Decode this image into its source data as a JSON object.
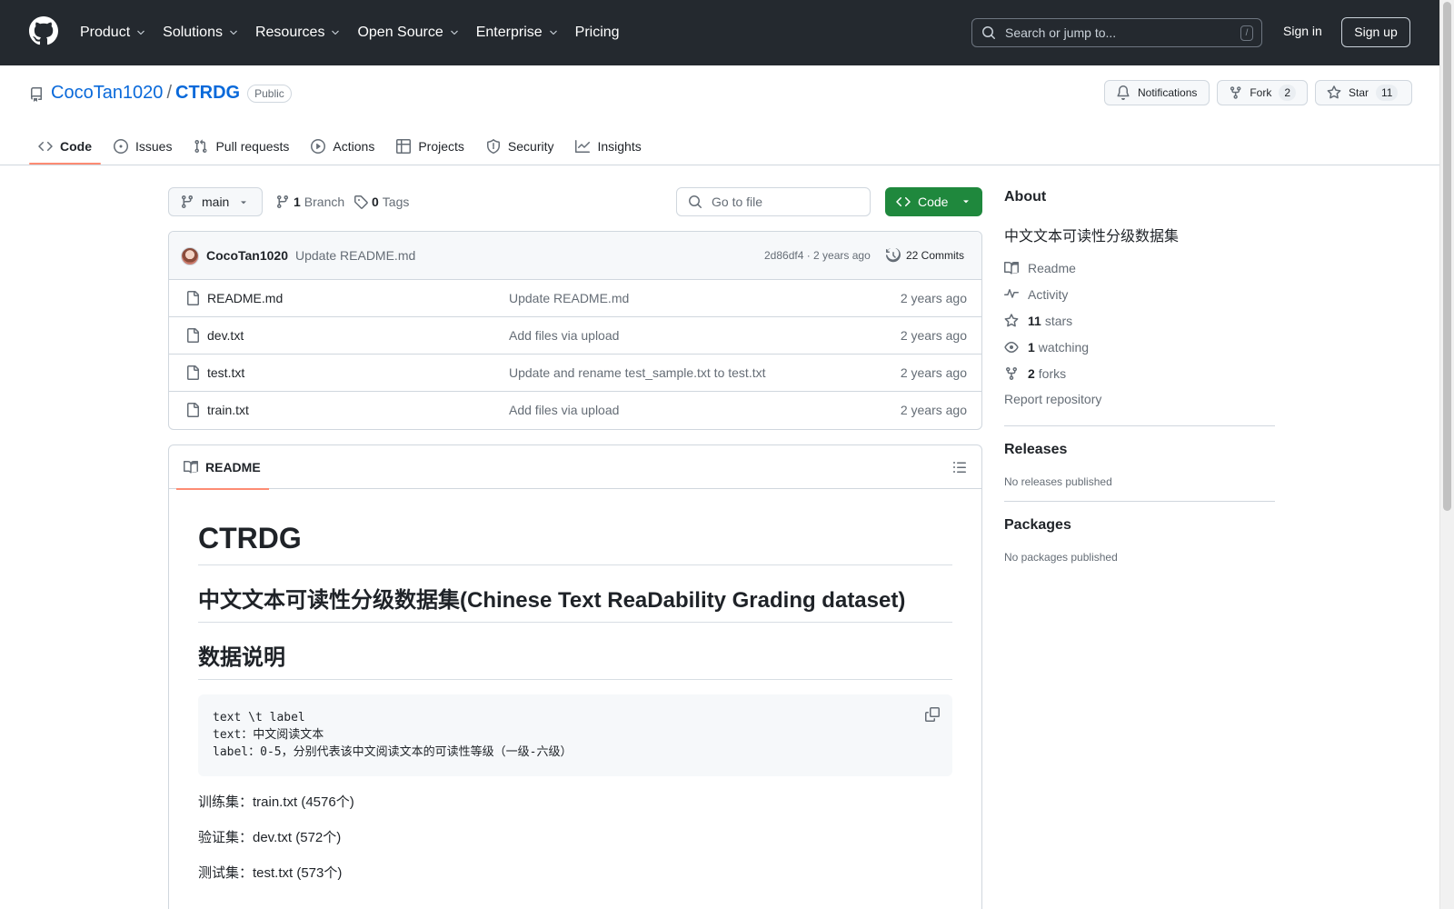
{
  "header": {
    "nav": [
      "Product",
      "Solutions",
      "Resources",
      "Open Source",
      "Enterprise",
      "Pricing"
    ],
    "search_placeholder": "Search or jump to...",
    "search_shortcut": "/",
    "sign_in": "Sign in",
    "sign_up": "Sign up"
  },
  "repo": {
    "owner": "CocoTan1020",
    "separator": "/",
    "name": "CTRDG",
    "visibility": "Public",
    "notifications_label": "Notifications",
    "fork_label": "Fork",
    "fork_count": "2",
    "star_label": "Star",
    "star_count": "11"
  },
  "tabs": [
    "Code",
    "Issues",
    "Pull requests",
    "Actions",
    "Projects",
    "Security",
    "Insights"
  ],
  "toolbar": {
    "branch": "main",
    "branch_count": "1",
    "branch_label": "Branch",
    "tag_count": "0",
    "tag_label": "Tags",
    "goto_placeholder": "Go to file",
    "code_label": "Code"
  },
  "commit": {
    "author": "CocoTan1020",
    "message": "Update README.md",
    "meta": "2d86df4 · 2 years ago",
    "commits": "22 Commits"
  },
  "files": [
    {
      "name": "README.md",
      "message": "Update README.md",
      "time": "2 years ago"
    },
    {
      "name": "dev.txt",
      "message": "Add files via upload",
      "time": "2 years ago"
    },
    {
      "name": "test.txt",
      "message": "Update and rename test_sample.txt to test.txt",
      "time": "2 years ago"
    },
    {
      "name": "train.txt",
      "message": "Add files via upload",
      "time": "2 years ago"
    }
  ],
  "readme": {
    "tab": "README",
    "h1": "CTRDG",
    "h2_title": "中文文本可读性分级数据集(Chinese Text ReaDability Grading dataset)",
    "h2_data": "数据说明",
    "code_lines": [
      "text \\t label",
      "text：中文阅读文本",
      "label：0-5，分别代表该中文阅读文本的可读性等级（一级-六级）"
    ],
    "paragraphs": [
      "训练集：train.txt (4576个)",
      "验证集：dev.txt (572个)",
      "测试集：test.txt (573个)"
    ]
  },
  "about": {
    "title": "About",
    "description": "中文文本可读性分级数据集",
    "readme": "Readme",
    "activity": "Activity",
    "stars_count": "11",
    "stars_label": "stars",
    "watching_count": "1",
    "watching_label": "watching",
    "forks_count": "2",
    "forks_label": "forks",
    "report": "Report repository"
  },
  "releases": {
    "title": "Releases",
    "empty": "No releases published"
  },
  "packages": {
    "title": "Packages",
    "empty": "No packages published"
  }
}
